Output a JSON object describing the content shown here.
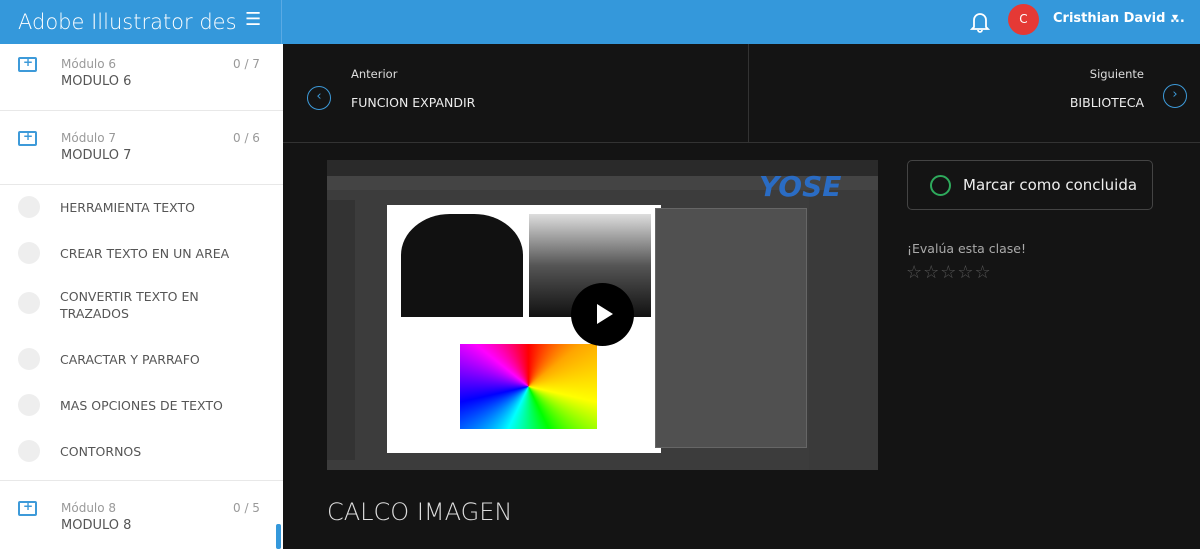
{
  "header": {
    "course_title": "Adobe Illustrator desde",
    "menu_icon": "☰",
    "user_initial": "C",
    "user_name": "Cristhian David ...",
    "chevron": "⌄"
  },
  "sidebar": {
    "modules": [
      {
        "sub": "Módulo 6",
        "name": "MODULO 6",
        "count": "0 / 7"
      },
      {
        "sub": "Módulo 7",
        "name": "MODULO 7",
        "count": "0 / 6"
      }
    ],
    "lessons": [
      "HERRAMIENTA TEXTO",
      "CREAR TEXTO EN UN AREA",
      "CONVERTIR TEXTO EN TRAZADOS",
      "CARACTAR Y PARRAFO",
      "MAS OPCIONES DE TEXTO",
      "CONTORNOS"
    ],
    "module8": {
      "sub": "Módulo 8",
      "name": "MODULO 8",
      "count": "0 / 5"
    }
  },
  "nav": {
    "prev_label": "Anterior",
    "prev_title": "FUNCION EXPANDIR",
    "next_label": "Siguiente",
    "next_title": "BIBLIOTECA",
    "prev_icon": "‹",
    "next_icon": "›"
  },
  "video": {
    "watermark": "YOSE"
  },
  "lesson": {
    "title": "CALCO IMAGEN",
    "mark_done": "Marcar como concluida",
    "rate_prompt": "¡Evalúa esta clase!",
    "stars": "☆☆☆☆☆",
    "rating": 0
  }
}
